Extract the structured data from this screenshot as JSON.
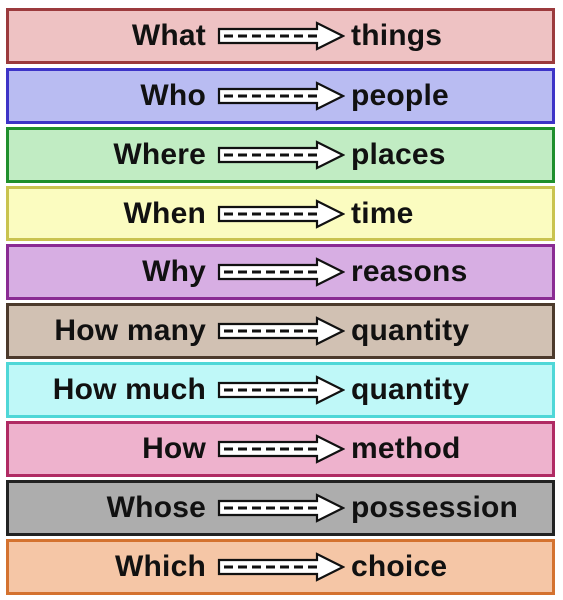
{
  "rows": [
    {
      "question": "What",
      "answer": "things",
      "bg": "#eec2c3",
      "border": "#9b3a3d"
    },
    {
      "question": "Who",
      "answer": "people",
      "bg": "#b9bcf2",
      "border": "#3d33c7"
    },
    {
      "question": "Where",
      "answer": "places",
      "bg": "#c1ecc3",
      "border": "#1f8f2c"
    },
    {
      "question": "When",
      "answer": "time",
      "bg": "#fbfcc0",
      "border": "#c9c34f"
    },
    {
      "question": "Why",
      "answer": "reasons",
      "bg": "#d7aee3",
      "border": "#8a2b93"
    },
    {
      "question": "How many",
      "answer": "quantity",
      "bg": "#d1c1b3",
      "border": "#4c3a2c"
    },
    {
      "question": "How much",
      "answer": "quantity",
      "bg": "#bff8f8",
      "border": "#4fd7d7"
    },
    {
      "question": "How",
      "answer": "method",
      "bg": "#eeb2cd",
      "border": "#b02a63"
    },
    {
      "question": "Whose",
      "answer": "possession",
      "bg": "#adadad",
      "border": "#222222"
    },
    {
      "question": "Which",
      "answer": "choice",
      "bg": "#f5c6a6",
      "border": "#d4722f"
    }
  ]
}
